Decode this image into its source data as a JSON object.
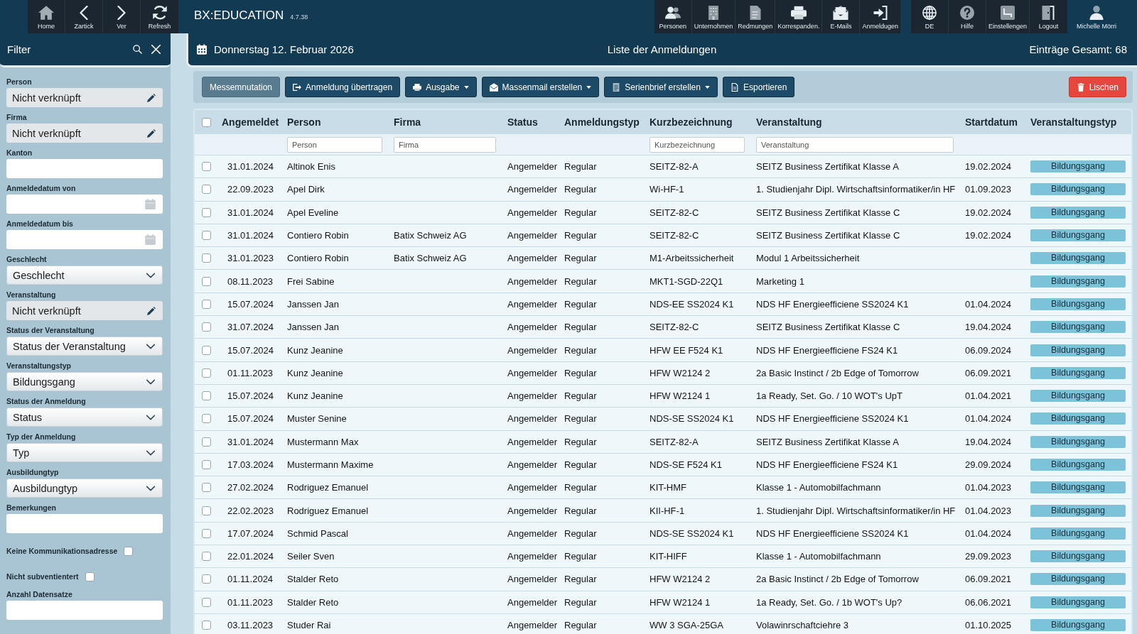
{
  "top_bar": {
    "nav": [
      {
        "label": "Home"
      },
      {
        "label": "Zartick"
      },
      {
        "label": "Ver"
      },
      {
        "label": "Refresh"
      }
    ],
    "app_title": "BX:EDUCATION",
    "version": "4.7.38",
    "modules": [
      {
        "label": "Personen"
      },
      {
        "label": "Unternohmen"
      },
      {
        "label": "Redmungen"
      },
      {
        "label": "Korrespanden."
      },
      {
        "label": "E-Mails"
      },
      {
        "label": "Anmeldugen"
      }
    ],
    "system": [
      {
        "label": "DE"
      },
      {
        "label": "Hilfe"
      },
      {
        "label": "Einstellengen"
      },
      {
        "label": "Logout"
      }
    ],
    "user": {
      "name": "Michelle Mörri"
    }
  },
  "filter_panel": {
    "title": "Filter",
    "fields": [
      {
        "kind": "link",
        "label": "Person",
        "value": "Nicht verknüpft"
      },
      {
        "kind": "link",
        "label": "Firma",
        "value": "Nicht verknüpft"
      },
      {
        "kind": "text",
        "label": "Kanton"
      },
      {
        "kind": "date",
        "label": "Anmeldedatum von"
      },
      {
        "kind": "date",
        "label": "Anmeldedatum bis"
      },
      {
        "kind": "select",
        "label": "Geschlecht",
        "value": "Geschlecht"
      },
      {
        "kind": "link",
        "label": "Veranstaltung",
        "value": "Nicht verknüpft"
      },
      {
        "kind": "select",
        "label": "Status der Veranstaltung",
        "value": "Status der Veranstaltung"
      },
      {
        "kind": "select",
        "label": "Veranstaltungstyp",
        "value": "Bildungsgang"
      },
      {
        "kind": "select",
        "label": "Status der Anmeldung",
        "value": "Status"
      },
      {
        "kind": "select",
        "label": "Typ der Anmeldung",
        "value": "Typ"
      },
      {
        "kind": "select",
        "label": "Ausbildungtyp",
        "value": "Ausbildungtyp"
      },
      {
        "kind": "text",
        "label": "Bemerkungen"
      },
      {
        "kind": "checkbox",
        "label": "Keine Kommunikationsadresse",
        "checked": false
      },
      {
        "kind": "checkbox",
        "label": "Nicht subventientert",
        "checked": false
      },
      {
        "kind": "text",
        "label": "Anzahl Datensatze"
      }
    ]
  },
  "header": {
    "date": "Donnerstag 12. Februar 2026",
    "title": "Liste der Anmeldungen",
    "total": "Einträge Gesamt: 68"
  },
  "toolbar": {
    "buttons": [
      {
        "kind": "secondary",
        "label": "Messemnutation",
        "dropdown": false
      },
      {
        "kind": "primary",
        "label": "Anmeldung übertragen",
        "dropdown": false
      },
      {
        "kind": "primary",
        "label": "Ausgabe",
        "dropdown": true
      },
      {
        "kind": "primary",
        "label": "Massenmail erstellen",
        "dropdown": true
      },
      {
        "kind": "primary",
        "label": "Serienbrief erstellen",
        "dropdown": true
      },
      {
        "kind": "primary",
        "label": "Esportieren",
        "dropdown": false
      },
      {
        "kind": "danger",
        "label": "Lischen",
        "dropdown": false
      }
    ]
  },
  "table": {
    "select_all": {
      "checked": false
    },
    "columns": [
      {
        "label": "Angemeldet"
      },
      {
        "label": "Person",
        "filter": {
          "placeholder": "Person"
        }
      },
      {
        "label": "Firma",
        "filter": {
          "placeholder": "Firma"
        }
      },
      {
        "label": "Status"
      },
      {
        "label": "Anmeldungstyp"
      },
      {
        "label": "Kurzbezeichnung",
        "filter": {
          "placeholder": "Kurzbezeichnung"
        }
      },
      {
        "label": "Veranstaltung",
        "filter": {
          "placeholder": "Veranstaltung"
        }
      },
      {
        "label": "Startdatum"
      },
      {
        "label": "Veranstaltungstyp"
      }
    ],
    "rows": [
      {
        "checked": false,
        "registered": "31.01.2024",
        "person": "Altinok Enis",
        "status": "Angemelder",
        "registration_type": "Regular",
        "short_name": "SEITZ-82-A",
        "event": "SEITZ Business Zertifikat Klasse A",
        "start_date": "19.02.2024",
        "event_type": "Bildungsgang"
      },
      {
        "checked": false,
        "registered": "22.09.2023",
        "person": "Apel Dirk",
        "status": "Angemelder",
        "registration_type": "Regular",
        "short_name": "Wi-HF-1",
        "event": "1. Studienjahr Dipl. Wirtschaftsinformatiker/in HF",
        "start_date": "01.09.2023",
        "event_type": "Bildungsgang"
      },
      {
        "checked": false,
        "registered": "31.01.2024",
        "person": "Apel Eveline",
        "status": "Angemelder",
        "registration_type": "Regular",
        "short_name": "SEITZ-82-C",
        "event": "SEITZ Business Zertifikat Klasse C",
        "start_date": "19.02.2024",
        "event_type": "Bildungsgang"
      },
      {
        "checked": false,
        "registered": "31.01.2024",
        "person": "Contiero Robin",
        "company": "Batix Schweiz AG",
        "status": "Angemelder",
        "registration_type": "Regular",
        "short_name": "SEITZ-82-C",
        "event": "SEITZ Business Zertifikat Klasse C",
        "start_date": "19.02.2024",
        "event_type": "Bildungsgang"
      },
      {
        "checked": false,
        "registered": "31.01.2023",
        "person": "Contiero Robin",
        "company": "Batix Schweiz AG",
        "status": "Angemelder",
        "registration_type": "Regular",
        "short_name": "M1-Arbeitssicherheit",
        "event": "Modul 1 Arbeitssicherheit",
        "event_type": "Bildungsgang"
      },
      {
        "checked": false,
        "registered": "08.11.2023",
        "person": "Frei Sabine",
        "status": "Angemelder",
        "registration_type": "Regular",
        "short_name": "MKT1-SGD-22Q1",
        "event": "Marketing 1",
        "event_type": "Bildungsgang"
      },
      {
        "checked": false,
        "registered": "15.07.2024",
        "person": "Janssen Jan",
        "status": "Angemelder",
        "registration_type": "Regular",
        "short_name": "NDS-EE SS2024 K1",
        "event": "NDS HF Energieefficiene SS2024 K1",
        "start_date": "01.04.2024",
        "event_type": "Bildungsgang"
      },
      {
        "checked": false,
        "registered": "31.07.2024",
        "person": "Janssen Jan",
        "status": "Angemelder",
        "registration_type": "Regular",
        "short_name": "SEITZ-82-C",
        "event": "SEITZ Business Zertifikat Klasse C",
        "start_date": "19.04.2024",
        "event_type": "Bildungsgang"
      },
      {
        "checked": false,
        "registered": "15.07.2024",
        "person": "Kunz Jeanine",
        "status": "Angemelder",
        "registration_type": "Regular",
        "short_name": "HFW EE F524 K1",
        "event": "NDS HF Energieefficiene FS24 K1",
        "start_date": "06.09.2024",
        "event_type": "Bildungsgang"
      },
      {
        "checked": false,
        "registered": "01.11.2023",
        "person": "Kunz Jeanine",
        "status": "Angemelder",
        "registration_type": "Regular",
        "short_name": "HFW W2124 2",
        "event": "2a Basic Instinct / 2b Edge of Tomorrow",
        "start_date": "06.09.2021",
        "event_type": "Bildungsgang"
      },
      {
        "checked": false,
        "registered": "15.07.2024",
        "person": "Kunz Jeanine",
        "status": "Angemelder",
        "registration_type": "Regular",
        "short_name": "HFW W2124 1",
        "event": "1a Ready, Set. Go. / 10 WOT's UpT",
        "start_date": "01.04.2021",
        "event_type": "Bildungsgang"
      },
      {
        "checked": false,
        "registered": "15.07.2024",
        "person": "Muster Senine",
        "status": "Angemelder",
        "registration_type": "Regular",
        "short_name": "NDS-SE SS2024 K1",
        "event": "NDS HF Energieefficiene SS2024 K1",
        "start_date": "01.04.2024",
        "event_type": "Bildungsgang"
      },
      {
        "checked": false,
        "registered": "31.01.2024",
        "person": "Mustermann Max",
        "status": "Angemelder",
        "registration_type": "Regular",
        "short_name": "SEITZ-82-A",
        "event": "SEITZ Business Zertifikat Klasse A",
        "start_date": "19.04.2024",
        "event_type": "Bildungsgang"
      },
      {
        "checked": false,
        "registered": "17.03.2024",
        "person": "Mustermann Maxime",
        "status": "Angemelder",
        "registration_type": "Regular",
        "short_name": "NDS-SE F524 K1",
        "event": "NDS HF Energieefficiene FS24 K1",
        "start_date": "29.09.2024",
        "event_type": "Bildungsgang"
      },
      {
        "checked": false,
        "registered": "27.02.2024",
        "person": "Rodriguez Emanuel",
        "status": "Angemelder",
        "registration_type": "Regular",
        "short_name": "KIT-HMF",
        "event": "Klasse 1 - Automobilfachmann",
        "start_date": "01.04.2023",
        "event_type": "Bildungsgang"
      },
      {
        "checked": false,
        "registered": "22.02.2023",
        "person": "Rodriguez Emanuel",
        "status": "Angemelder",
        "registration_type": "Regular",
        "short_name": "KII-HF-1",
        "event": "1. Studienjahr Dipl. Wirtschaftsinformatiker/in HF",
        "start_date": "01.04.2023",
        "event_type": "Bildungsgang"
      },
      {
        "checked": false,
        "registered": "17.07.2024",
        "person": "Schmid Pascal",
        "status": "Angemelder",
        "registration_type": "Regular",
        "short_name": "NDS-SE SS2024 K1",
        "event": "NDS HF Energieefficiene SS2024 K1",
        "start_date": "01.04.2024",
        "event_type": "Bildungsgang"
      },
      {
        "checked": false,
        "registered": "22.01.2024",
        "person": "Seiler Sven",
        "status": "Angemelder",
        "registration_type": "Regular",
        "short_name": "KIT-HIFF",
        "event": "Klasse 1 - Automobilfachmann",
        "start_date": "29.09.2023",
        "event_type": "Bildungsgang"
      },
      {
        "checked": false,
        "registered": "01.11.2024",
        "person": "Stalder Reto",
        "status": "Angemelder",
        "registration_type": "Regular",
        "short_name": "HFW W2124 2",
        "event": "2a Basic Instinct / 2b Edge of Tomorrow",
        "start_date": "06.09.2021",
        "event_type": "Bildungsgang"
      },
      {
        "checked": false,
        "registered": "01.11.2023",
        "person": "Stalder Reto",
        "status": "Angemelder",
        "registration_type": "Regular",
        "short_name": "HFW W2124 1",
        "event": "1a Ready, Set. Go. / 1b WOT's Up?",
        "start_date": "06.06.2021",
        "event_type": "Bildungsgang"
      },
      {
        "checked": false,
        "registered": "03.11.2023",
        "person": "Studer Rai",
        "status": "Angemelder",
        "registration_type": "Regular",
        "short_name": "WW 3 SGA-25GA",
        "event": "Volawinrschaftciehre 3",
        "start_date": "01.10.2025",
        "event_type": "Bildungsgang"
      }
    ]
  }
}
